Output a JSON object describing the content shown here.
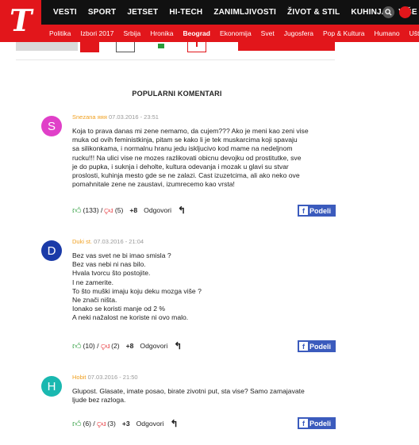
{
  "logo_text": "T",
  "main_nav": [
    "VESTI",
    "SPORT",
    "JETSET",
    "HI-TECH",
    "ZANIMLJIVOSTI",
    "ŽIVOT & STIL",
    "KUHINJA",
    "VIŠE"
  ],
  "sub_nav": [
    "Politika",
    "Izbori 2017",
    "Srbija",
    "Hronika",
    "Beograd",
    "Ekonomija",
    "Svet",
    "Jugosfera",
    "Pop & Kultura",
    "Humano",
    "Ušte"
  ],
  "active_sub": "Beograd",
  "section_title": "POPULARNI KOMENTARI",
  "reply_label": "Odgovori",
  "share_label": "Podeli",
  "colors": {
    "brand_red": "#e2161b",
    "facebook": "#3b5bbd",
    "like_green": "#2a9b3a",
    "author_orange": "#f0a020"
  },
  "comments": [
    {
      "initial": "S",
      "avatar_color": "#e040c8",
      "author": "Snezana яяя",
      "date": "07.03.2016 - 23:51",
      "text": "Koja to prava danas mi zene nemamo, da cujem??? Ako je meni kao zeni vise\nmuka od ovih feministkinja, pitam se kako li je tek muskarcima koji spavaju\nsa silikonkama, i normalnu hranu jedu iskljucivo kod mame na nedeljnom\nrucku!!! Na ulici vise ne mozes razlikovati obicnu devojku od prostitutke, sve\nje do pupka, i suknja i deholte, kultura odevanja i mozak u glavi su stvar\nproslosti, kuhinja mesto gde se ne zalazi. Cast izuzetcima, ali ako neko ove\npomahnitale zene ne zaustavi, izumrecemo kao vrsta!",
      "likes": "(133)",
      "dislikes": "(5)",
      "score": "+8"
    },
    {
      "initial": "D",
      "avatar_color": "#1a3aa8",
      "author": "Duki st.",
      "date": "07.03.2016 - 21:04",
      "text": "Bez vas svet ne bi imao smisla ?\nBez vas nebi ni nas bilo.\nHvala tvorcu što postojite.\nI ne zamerite.\nTo što muški imaju koju deku mozga više ?\nNe znači ništa.\nIonako se koristi manje od 2 %\nA neki nažalost ne koriste ni ovo malo.",
      "likes": "(10)",
      "dislikes": "(2)",
      "score": "+8"
    },
    {
      "initial": "H",
      "avatar_color": "#1ab8b0",
      "author": "Hobit",
      "date": "07.03.2016 - 21:50",
      "text": "Glupost. Glasate, imate posao, birate zivotni put, sta vise? Samo zamajavate\nljude bez razloga.",
      "likes": "(6)",
      "dislikes": "(3)",
      "score": "+3"
    }
  ]
}
